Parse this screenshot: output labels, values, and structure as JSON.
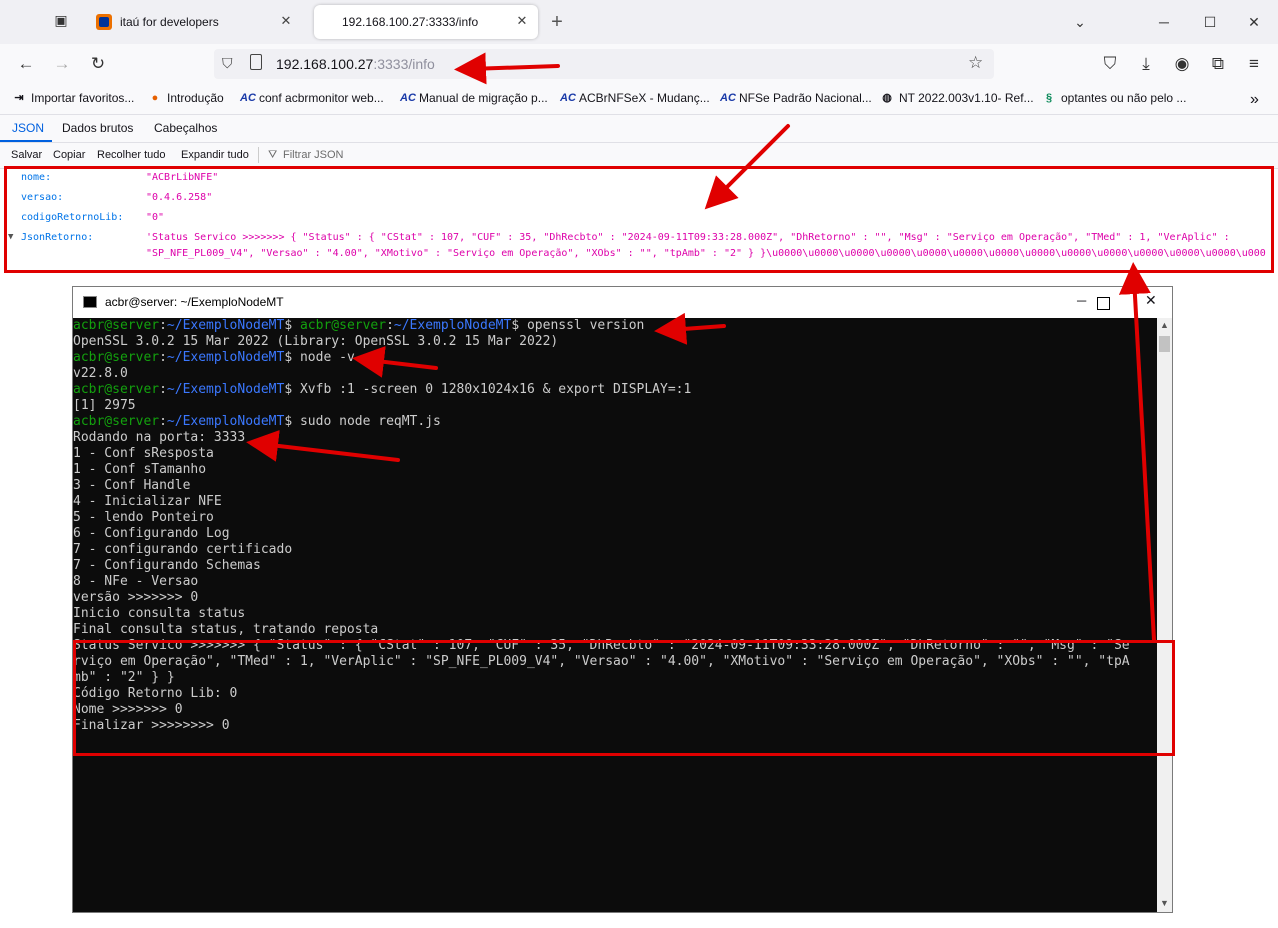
{
  "browser": {
    "tabs": [
      {
        "label": "itaú for developers"
      },
      {
        "label": "192.168.100.27:3333/info"
      }
    ],
    "url": {
      "host": "192.168.100.27",
      "rest": ":3333/info"
    },
    "bookmarks": [
      {
        "label": "Importar favoritos..."
      },
      {
        "label": "Introdução"
      },
      {
        "label": "conf acbrmonitor web..."
      },
      {
        "label": "Manual de migração p..."
      },
      {
        "label": "ACBrNFSeX - Mudanç..."
      },
      {
        "label": "NFSe Padrão Nacional..."
      },
      {
        "label": "NT 2022.003v1.10- Ref..."
      },
      {
        "label": "optantes ou não pelo ..."
      }
    ]
  },
  "json_viewer": {
    "tabs": [
      "JSON",
      "Dados brutos",
      "Cabeçalhos"
    ],
    "toolbar": [
      "Salvar",
      "Copiar",
      "Recolher tudo",
      "Expandir tudo",
      "Filtrar JSON"
    ],
    "rows": [
      {
        "key": "nome:",
        "value": "\"ACBrLibNFE\""
      },
      {
        "key": "versao:",
        "value": "\"0.4.6.258\""
      },
      {
        "key": "codigoRetornoLib:",
        "value": "\"0\""
      },
      {
        "key": "JsonRetorno:",
        "value": "'Status Servico >>>>>>> { \"Status\" : { \"CStat\" : 107, \"CUF\" : 35, \"DhRecbto\" : \"2024-09-11T09:33:28.000Z\", \"DhRetorno\" : \"\", \"Msg\" : \"Serviço em Operação\", \"TMed\" : 1, \"VerAplic\" :",
        "value2": "\"SP_NFE_PL009_V4\", \"Versao\" : \"4.00\", \"XMotivo\" : \"Serviço em Operação\", \"XObs\" : \"\", \"tpAmb\" : \"2\" } }\\u0000\\u0000\\u0000\\u0000\\u0000\\u0000\\u0000\\u0000\\u0000\\u0000\\u0000\\u0000\\u0000\\u0000"
      }
    ]
  },
  "terminal": {
    "title": "acbr@server: ~/ExemploNodeMT",
    "prompt_user": "acbr@server",
    "prompt_path": "~/ExemploNodeMT",
    "lines": {
      "l1_cmd": " openssl version",
      "l2": "OpenSSL 3.0.2 15 Mar 2022 (Library: OpenSSL 3.0.2 15 Mar 2022)",
      "l3_cmd": " node -v",
      "l4": "v22.8.0",
      "l5_cmd": " Xvfb :1 -screen 0 1280x1024x16 & export DISPLAY=:1",
      "l6": "[1] 2975",
      "l7_cmd": " sudo node reqMT.js",
      "l8": "Rodando na porta: 3333",
      "l9": "1 - Conf sResposta",
      "l10": "1 - Conf sTamanho",
      "l11": "3 - Conf Handle",
      "l12": "4 - Inicializar NFE",
      "l13": "5 - lendo Ponteiro",
      "l14": "6 - Configurando Log",
      "l15": "7 - configurando certificado",
      "l16": "7 - Configurando Schemas",
      "l17": "8 - NFe - Versao",
      "l18": "versão >>>>>>> 0",
      "l19": "Inicio consulta status",
      "l20": "Final consulta status, tratando reposta",
      "l21": "Status Servico >>>>>>> { \"Status\" : { \"CStat\" : 107, \"CUF\" : 35, \"DhRecbto\" : \"2024-09-11T09:33:28.000Z\", \"DhRetorno\" : \"\", \"Msg\" : \"Se",
      "l22": "rviço em Operação\", \"TMed\" : 1, \"VerAplic\" : \"SP_NFE_PL009_V4\", \"Versao\" : \"4.00\", \"XMotivo\" : \"Serviço em Operação\", \"XObs\" : \"\", \"tpA",
      "l23": "mb\" : \"2\" } }",
      "l24": "Código Retorno Lib: 0",
      "l25": "Nome >>>>>>> 0",
      "l26": "Finalizar >>>>>>>> 0"
    }
  },
  "colors": {
    "annotation": "#e00000",
    "prompt_user": "#13a10e",
    "prompt_path": "#3b78ff",
    "json_key": "#0074e8",
    "json_value": "#dd00a9"
  }
}
